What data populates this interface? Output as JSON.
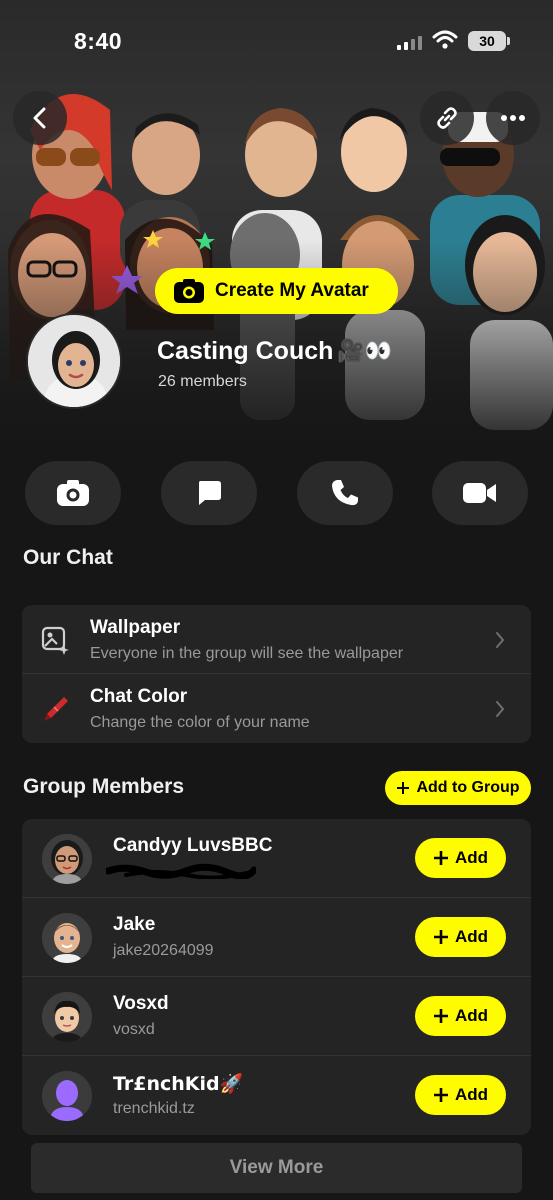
{
  "status_bar": {
    "time": "8:40",
    "battery": "30"
  },
  "header": {
    "create_avatar_label": "Create My Avatar",
    "group_name": "Casting Couch",
    "group_name_emoji": "🎥👀",
    "member_count": "26 members"
  },
  "actions": [
    {
      "name": "camera",
      "icon": "camera-icon"
    },
    {
      "name": "chat",
      "icon": "chat-bubble-icon"
    },
    {
      "name": "call",
      "icon": "phone-icon"
    },
    {
      "name": "video",
      "icon": "video-camera-icon"
    }
  ],
  "our_chat": {
    "title": "Our Chat",
    "items": [
      {
        "title": "Wallpaper",
        "subtitle": "Everyone in the group will see the wallpaper",
        "icon": "wallpaper-icon"
      },
      {
        "title": "Chat Color",
        "subtitle": "Change the color of your name",
        "icon": "crayon-icon"
      }
    ]
  },
  "group_members": {
    "title": "Group Members",
    "add_to_group_label": "Add to Group",
    "add_label": "Add",
    "members": [
      {
        "name": "Candyy LuvsBBC",
        "username": ""
      },
      {
        "name": "Jake",
        "username": "jake20264099"
      },
      {
        "name": "Vosxd",
        "username": "vosxd"
      },
      {
        "name": "Tr£nchKid🚀",
        "username": "trenchkid.tz"
      }
    ],
    "view_more_label": "View More"
  },
  "colors": {
    "accent": "#fffc00",
    "background": "#161616",
    "card": "#242424"
  }
}
